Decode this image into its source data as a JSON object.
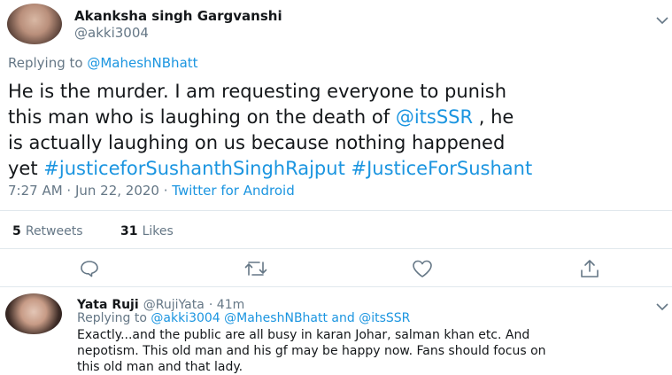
{
  "main_tweet": {
    "author_name": "Akanksha singh Gargvanshi",
    "author_handle": "@akki3004",
    "replying_to_prefix": "Replying to",
    "replying_to_user": "@MaheshNBhatt",
    "text_line1": "He is the murder. I am requesting everyone to punish",
    "text_line2": "this man who is laughing on the death of",
    "text_line2_mention": "@itsSSR",
    "text_line2_end": ", he",
    "text_line3": "is actually laughing on us because nothing happened",
    "text_line4_start": "yet",
    "hashtag1": "#justiceforSushanthSinghRajput",
    "hashtag2": "#JusticeForSushant",
    "timestamp": "7:27 AM · Jun 22, 2020 ·",
    "source": "Twitter for Android",
    "retweets_count": "5",
    "retweets_label": "Retweets",
    "likes_count": "31",
    "likes_label": "Likes"
  },
  "reply_tweet": {
    "author_name": "Yata Ruji",
    "author_handle": "@RujiYata",
    "time_ago": "· 41m",
    "replying_to_prefix": "Replying to",
    "replying_to_users": "@akki3004 @MaheshNBhatt and @itsSSR",
    "text_line1": "Exactly...and the public are all busy in karan Johar, salman khan etc. And",
    "text_line2": "nepotism. This old man and his gf may be happy now. Fans should focus on",
    "text_line3": "this old man and that lady."
  },
  "icons": {
    "chevron": "chevron-down-icon",
    "reply": "comment-icon",
    "retweet": "retweet-icon",
    "like": "heart-icon",
    "share": "share-icon"
  },
  "colors": {
    "link": "#1b95e0",
    "muted": "#657786",
    "text": "#14171a",
    "divider": "#e1e8ed"
  }
}
